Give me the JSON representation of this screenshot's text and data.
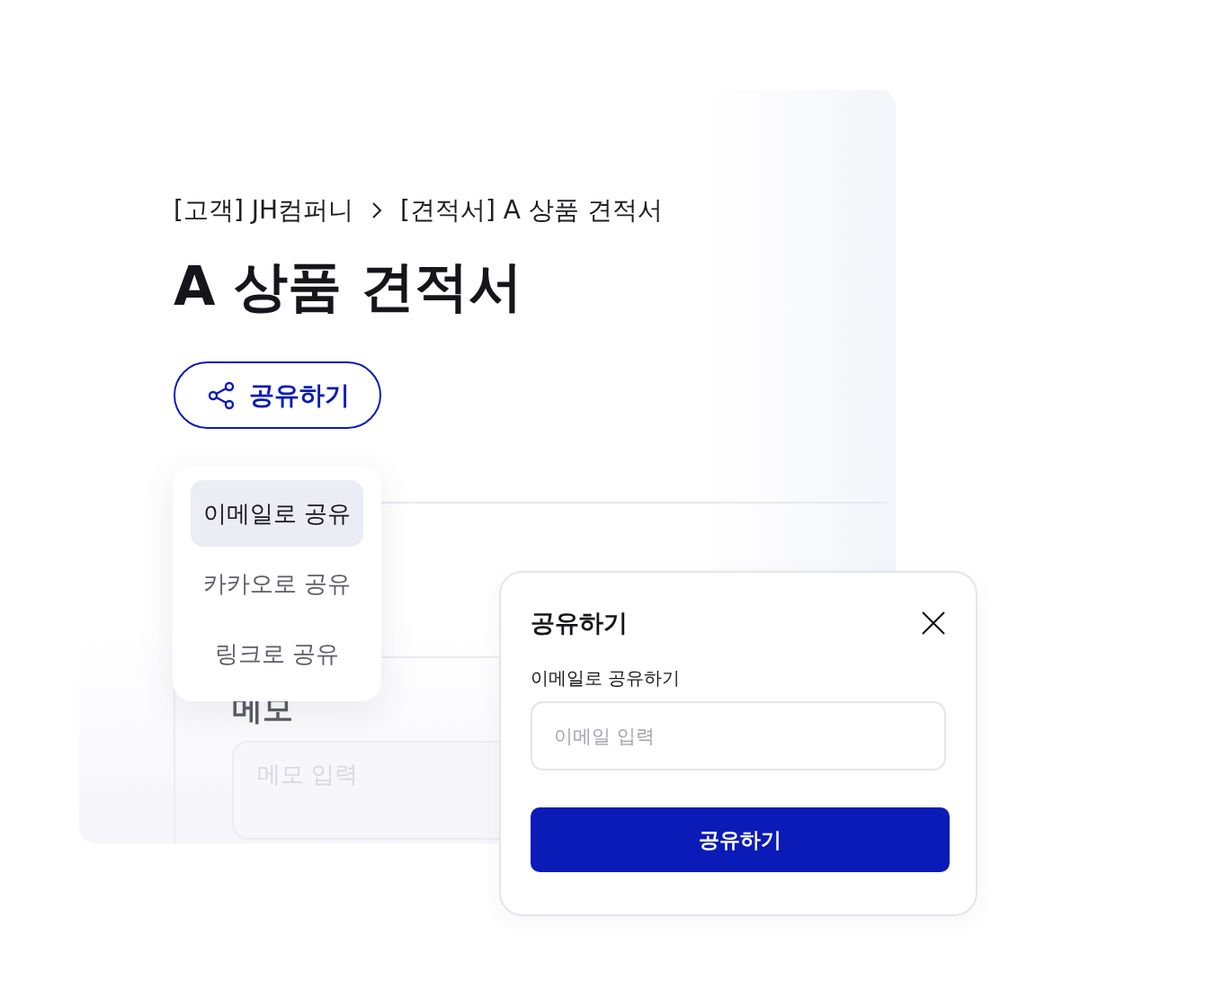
{
  "breadcrumb": [
    {
      "label": "[고객] JH컴퍼니"
    },
    {
      "label": "[견적서] A 상품 견적서"
    }
  ],
  "title": "A 상품 견적서",
  "share_button": {
    "label": "공유하기"
  },
  "share_menu": {
    "items": [
      {
        "label": "이메일로 공유",
        "selected": true
      },
      {
        "label": "카카오로 공유",
        "selected": false
      },
      {
        "label": "링크로 공유",
        "selected": false
      }
    ]
  },
  "memo": {
    "heading": "메모",
    "placeholder": "메모 입력"
  },
  "share_dialog": {
    "title": "공유하기",
    "field_label": "이메일로 공유하기",
    "placeholder": "이메일 입력",
    "submit": "공유하기"
  }
}
